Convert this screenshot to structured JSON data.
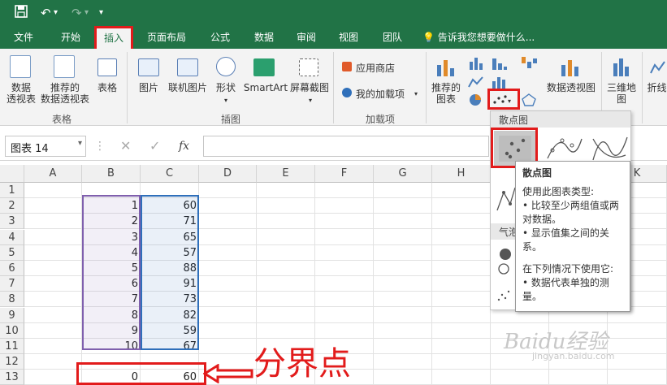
{
  "quick_access": {
    "save_icon": "save-icon",
    "undo_icon": "undo-icon",
    "redo_icon": "redo-icon",
    "more": "▾"
  },
  "tabs": [
    {
      "label": "文件"
    },
    {
      "label": "开始"
    },
    {
      "label": "插入",
      "active": true
    },
    {
      "label": "页面布局"
    },
    {
      "label": "公式"
    },
    {
      "label": "数据"
    },
    {
      "label": "审阅"
    },
    {
      "label": "视图"
    },
    {
      "label": "团队"
    }
  ],
  "tell_me": "告诉我您想要做什么...",
  "ribbon": {
    "tables": {
      "pivot": "数据\n透视表",
      "recommended_pivot": "推荐的\n数据透视表",
      "table": "表格",
      "group": "表格"
    },
    "illustrations": {
      "picture": "图片",
      "online_picture": "联机图片",
      "shapes": "形状",
      "smartart": "SmartArt",
      "screenshot": "屏幕截图",
      "group": "插图"
    },
    "addins": {
      "store": "应用商店",
      "my_addins": "我的加载项",
      "group": "加载项"
    },
    "charts": {
      "recommended": "推荐的\n图表",
      "pivot_chart": "数据透视图",
      "map3d": "三维地\n图",
      "line": "折线"
    }
  },
  "formula_bar": {
    "name_box": "图表 14",
    "fx": "fx"
  },
  "columns": [
    "A",
    "B",
    "C",
    "D",
    "E",
    "F",
    "G",
    "H",
    "I",
    "J",
    "K"
  ],
  "rows": [
    "1",
    "2",
    "3",
    "4",
    "5",
    "6",
    "7",
    "8",
    "9",
    "10",
    "11",
    "12",
    "13"
  ],
  "cells": {
    "B": [
      "",
      "1",
      "2",
      "3",
      "4",
      "5",
      "6",
      "7",
      "8",
      "9",
      "10",
      "",
      "0"
    ],
    "C": [
      "",
      "60",
      "71",
      "65",
      "57",
      "88",
      "91",
      "73",
      "82",
      "59",
      "67",
      "",
      "60"
    ]
  },
  "dropdown": {
    "scatter_header": "散点图",
    "bubble_header": "气泡"
  },
  "tooltip": {
    "title": "散点图",
    "lines": [
      "使用此图表类型:",
      "• 比较至少两组值或两",
      "对数据。",
      "• 显示值集之间的关",
      "系。",
      "",
      "在下列情况下使用它:",
      "• 数据代表单独的测",
      "量。"
    ]
  },
  "annotation": {
    "label": "分界点",
    "color": "#e21b1b"
  },
  "watermark": {
    "text": "Baidu经验",
    "sub": "jingyan.baidu.com"
  },
  "colors": {
    "excel_green": "#217346",
    "highlight_red": "#e21b1b",
    "range_b": "#7f5fad",
    "range_c": "#2f6fba"
  }
}
